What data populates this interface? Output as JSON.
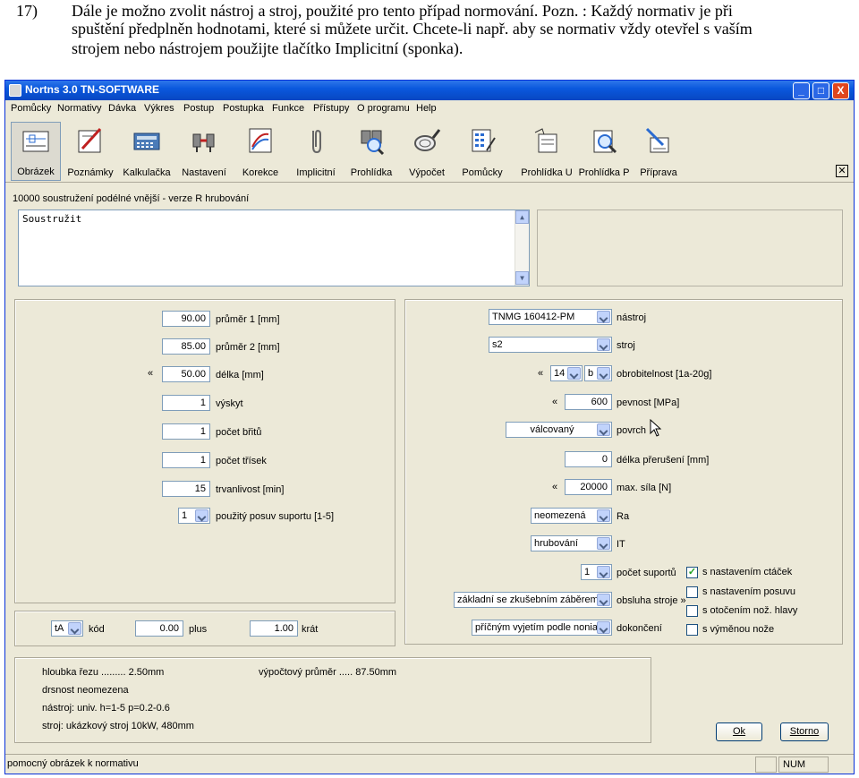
{
  "doc": {
    "num": "17)",
    "line1": "Dále je možno zvolit nástroj a stroj, použité pro tento případ normování. Pozn. : Každý normativ  je při",
    "line2": "spuštění předplněn hodnotami, které si můžete určit. Chcete-li např. aby se normativ vždy otevřel s vaším",
    "line3": "strojem nebo nástrojem použijte tlačítko Implicitní (sponka)."
  },
  "window": {
    "title": "Nortns 3.0 TN-SOFTWARE",
    "min": "_",
    "max": "□",
    "close": "X"
  },
  "menu": [
    "Pomůcky",
    "Normativy",
    "Dávka",
    "Výkres",
    "Postup",
    "Postupka",
    "Funkce",
    "Přístupy",
    "O programu",
    "Help"
  ],
  "toolbar": [
    {
      "label": "Obrázek",
      "icon": "image-icon"
    },
    {
      "label": "Poznámky",
      "icon": "notes-icon"
    },
    {
      "label": "Kalkulačka",
      "icon": "calculator-icon"
    },
    {
      "label": "Nastavení",
      "icon": "settings-icon"
    },
    {
      "label": "Korekce",
      "icon": "correction-icon"
    },
    {
      "label": "Implicitní",
      "icon": "paperclip-icon"
    },
    {
      "label": "Prohlídka",
      "icon": "preview-icon"
    },
    {
      "label": "Výpočet",
      "icon": "compute-icon"
    },
    {
      "label": "Pomůcky",
      "icon": "tools-icon"
    },
    {
      "label": "Prohlídka U",
      "icon": "preview-u-icon"
    },
    {
      "label": "Prohlídka P",
      "icon": "preview-p-icon"
    },
    {
      "label": "Příprava",
      "icon": "preparation-icon"
    }
  ],
  "caption": "10000 soustružení podélné vnější - verze R hrubování",
  "note_text": "Soustružit",
  "left_fields": [
    {
      "value": "90.00",
      "label": "průměr 1 [mm]"
    },
    {
      "value": "85.00",
      "label": "průměr 2 [mm]"
    },
    {
      "value": "50.00",
      "label": "délka [mm]"
    },
    {
      "value": "1",
      "label": "výskyt"
    },
    {
      "value": "1",
      "label": "počet břitů"
    },
    {
      "value": "1",
      "label": "počet třísek"
    },
    {
      "value": "15",
      "label": "trvanlivost [min]"
    }
  ],
  "chev": "«",
  "posuv": {
    "value": "1",
    "label": "použitý posuv suportu [1-5]"
  },
  "right": {
    "nastroj": {
      "value": "TNMG 160412-PM",
      "label": "nástroj"
    },
    "stroj": {
      "value": "s2",
      "label": "stroj"
    },
    "obrob": {
      "v1": "14",
      "v2": "b",
      "label": "obrobitelnost [1a-20g]"
    },
    "pevnost": {
      "value": "600",
      "label": "pevnost [MPa]"
    },
    "povrch": {
      "value": "válcovaný",
      "label": "povrch"
    },
    "preruseni": {
      "value": "0",
      "label": "délka přerušení [mm]"
    },
    "sila": {
      "value": "20000",
      "label": "max. síla [N]"
    },
    "ra": {
      "value": "neomezená",
      "label": "Ra"
    },
    "it": {
      "value": "hrubování",
      "label": "IT"
    },
    "suportu": {
      "value": "1",
      "label": "počet suportů"
    },
    "obsluha": {
      "value": "základní se zkušebním záběrem",
      "label": "obsluha stroje »"
    },
    "dokonceni": {
      "value": "příčným vyjetím podle nonia",
      "label": "dokončení"
    }
  },
  "checks": [
    {
      "label": "s nastavením ctáček",
      "checked": true
    },
    {
      "label": "s nastavením posuvu",
      "checked": false
    },
    {
      "label": "s otočením nož. hlavy",
      "checked": false
    },
    {
      "label": "s výměnou nože",
      "checked": false
    }
  ],
  "code_row": {
    "kod_value": "tA",
    "kod_label": "kód",
    "plus_value": "0.00",
    "plus_label": "plus",
    "krat_value": "1.00",
    "krat_label": "krát"
  },
  "info": {
    "hloubka": "hloubka řezu ......... 2.50mm",
    "prumer": "výpočtový průměr .....     87.50mm",
    "drsnost": "drsnost neomezena",
    "nastroj": "nástroj: univ. h=1-5 p=0.2-0.6",
    "stroj": "stroj: ukázkový stroj 10kW, 480mm"
  },
  "buttons": {
    "ok": "Ok",
    "storno": "Storno"
  },
  "status": {
    "text": "pomocný obrázek k normativu",
    "num": "NUM"
  }
}
